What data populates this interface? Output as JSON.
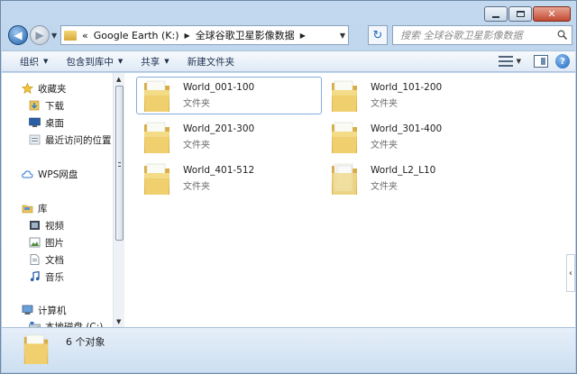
{
  "address": {
    "overflow": "«",
    "crumbs": [
      "Google Earth (K:)",
      "全球谷歌卫星影像数据"
    ]
  },
  "search": {
    "placeholder": "搜索 全球谷歌卫星影像数据"
  },
  "toolbar": {
    "organize": "组织",
    "include_library": "包含到库中",
    "share": "共享",
    "new_folder": "新建文件夹"
  },
  "nav": {
    "favorites": "收藏夹",
    "downloads": "下载",
    "desktop": "桌面",
    "recent": "最近访问的位置",
    "wps": "WPS网盘",
    "libraries": "库",
    "videos": "视频",
    "pictures": "图片",
    "documents": "文档",
    "music": "音乐",
    "computer": "计算机",
    "local_disk": "本地磁盘 (C:)"
  },
  "files": [
    {
      "name": "World_001-100",
      "type": "文件夹"
    },
    {
      "name": "World_101-200",
      "type": "文件夹"
    },
    {
      "name": "World_201-300",
      "type": "文件夹"
    },
    {
      "name": "World_301-400",
      "type": "文件夹"
    },
    {
      "name": "World_401-512",
      "type": "文件夹"
    },
    {
      "name": "World_L2_L10",
      "type": "文件夹"
    }
  ],
  "status": {
    "count_text": "6 个对象"
  },
  "colors": {
    "folder": "#e9c45a",
    "window_frame": "#bcd3ea",
    "selection_border": "#84acdd"
  }
}
